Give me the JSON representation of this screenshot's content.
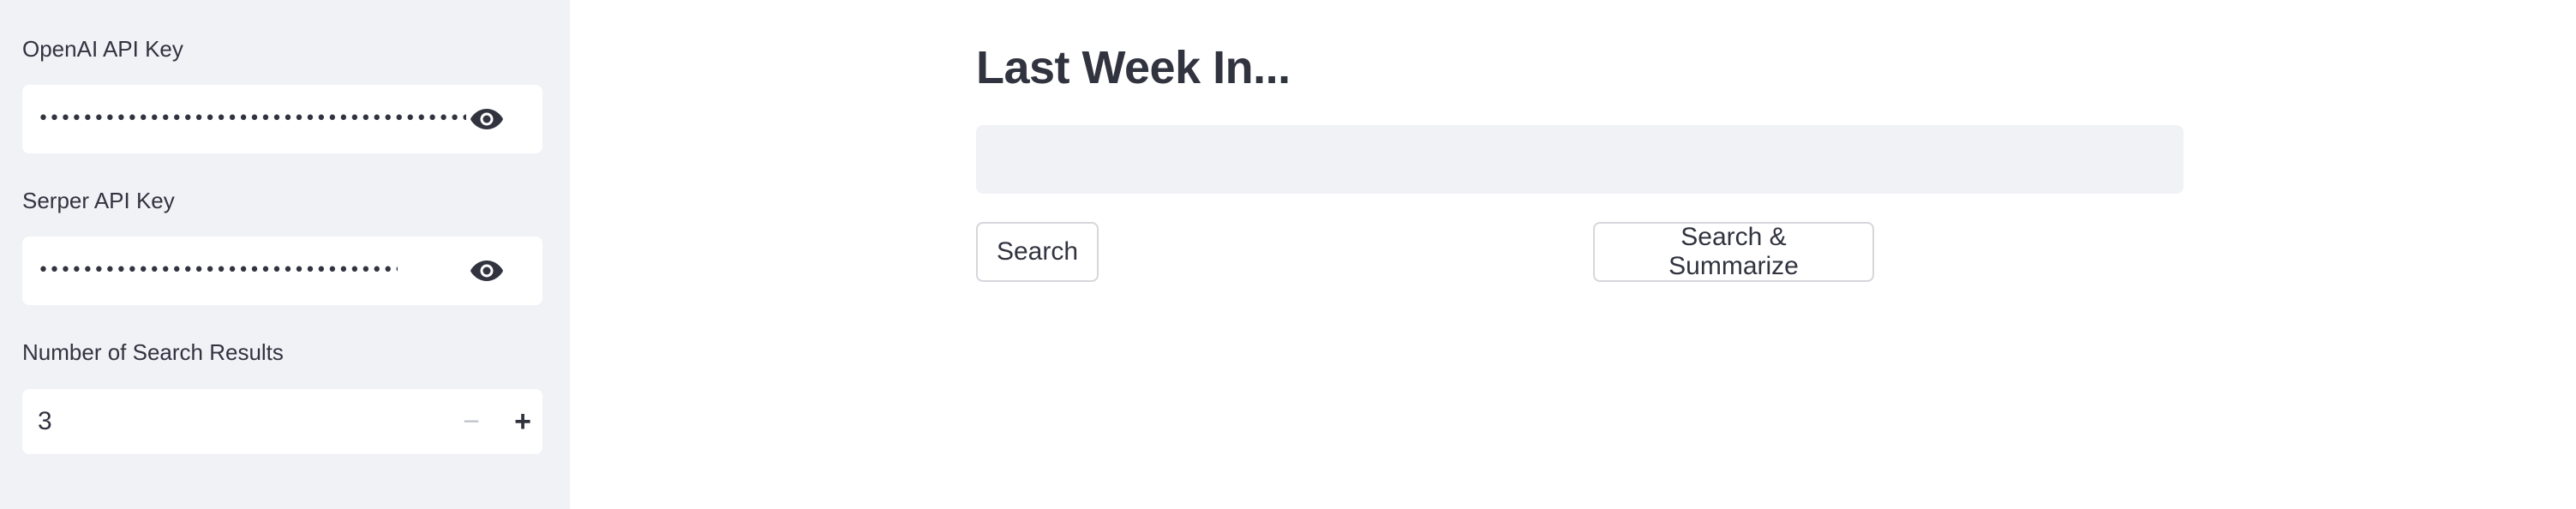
{
  "sidebar": {
    "openai_key": {
      "label": "OpenAI API Key",
      "masked_value": "••••••••••••••••••••••••••••••••••••••••••••••••••••",
      "toggle_icon": "eye-icon"
    },
    "serper_key": {
      "label": "Serper API Key",
      "masked_value": "••••••••••••••••••••••••••••••••••••••••",
      "toggle_icon": "eye-icon"
    },
    "num_results": {
      "label": "Number of Search Results",
      "value": "3",
      "decrement_symbol": "−",
      "increment_symbol": "+"
    }
  },
  "main": {
    "title": "Last Week In...",
    "topic_input": {
      "value": "",
      "placeholder": ""
    },
    "buttons": {
      "search": "Search",
      "search_summarize": "Search & Summarize"
    }
  },
  "colors": {
    "sidebar_bg": "#f0f2f6",
    "text": "#31333f",
    "input_bg": "#f0f2f6",
    "button_border": "#d6d7dc"
  }
}
